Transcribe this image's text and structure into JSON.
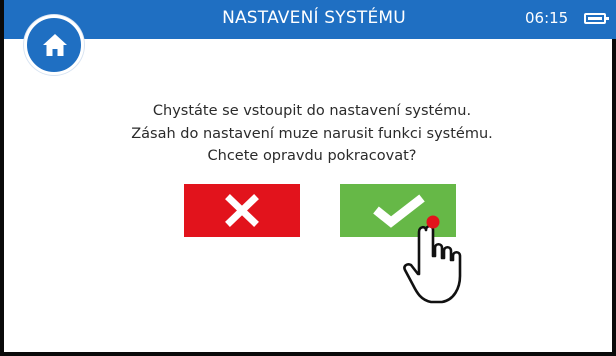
{
  "header": {
    "title": "NASTAVENÍ SYSTÉMU",
    "time": "06:15",
    "home_icon": "home-icon",
    "battery_icon": "battery-icon"
  },
  "dialog": {
    "lines": [
      "Chystáte se vstoupit do nastavení systému.",
      "Zásah do nastavení muze narusit funkci systému.",
      "Chcete opravdu pokracovat?"
    ],
    "cancel_icon": "close-icon",
    "confirm_icon": "checkmark-icon"
  },
  "pointer_icon": "hand-pointer-icon",
  "colors": {
    "header": "#1f6fc2",
    "cancel": "#e2131c",
    "confirm": "#66b847",
    "touch_dot": "#e2131c"
  }
}
